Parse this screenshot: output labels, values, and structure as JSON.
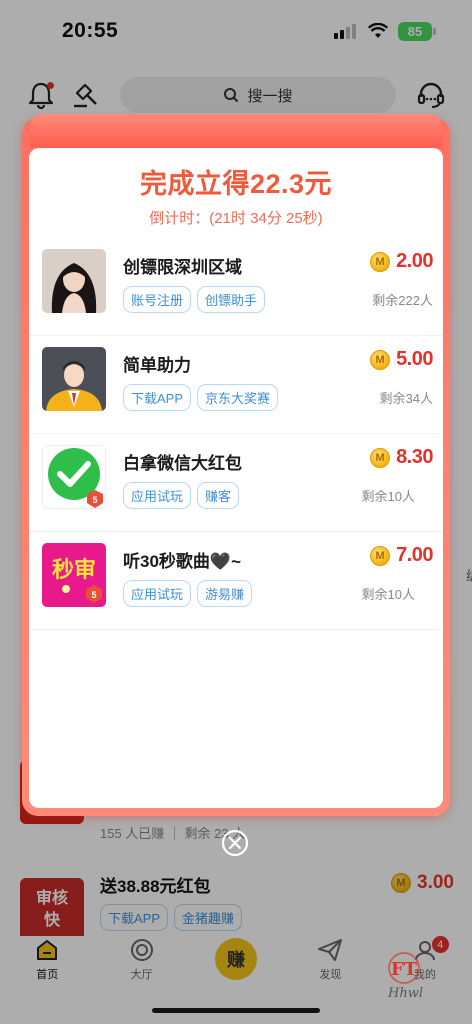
{
  "status_bar": {
    "time": "20:55",
    "battery": "85"
  },
  "header": {
    "search_placeholder": "搜一搜",
    "icons": [
      "bell-icon",
      "gavel-icon",
      "search-icon",
      "headset-icon"
    ]
  },
  "background": {
    "row2_stat": "155 人已赚 ｜ 剩余 23 人",
    "row3": {
      "thumb_text": [
        "审核",
        "快"
      ],
      "title": "送38.88元红包",
      "tags": [
        "下载APP",
        "金猪趣赚"
      ],
      "amount": "3.00"
    },
    "side_char": "编"
  },
  "popup": {
    "title": "完成立得22.3元",
    "countdown": "倒计时：(21时 34分 25秒)",
    "coin_label": "M",
    "tasks": [
      {
        "name": "创镖限深圳区域",
        "amount": "2.00",
        "tags": [
          "账号注册",
          "创镖助手"
        ],
        "remaining": "剩余222人"
      },
      {
        "name": "简单助力",
        "amount": "5.00",
        "tags": [
          "下载APP",
          "京东大奖赛"
        ],
        "remaining": "剩余34人"
      },
      {
        "name": "白拿微信大红包",
        "amount": "8.30",
        "tags": [
          "应用试玩",
          "赚客"
        ],
        "remaining": "剩余10人"
      },
      {
        "name": "听30秒歌曲🖤~",
        "amount": "7.00",
        "tags": [
          "应用试玩",
          "游易赚"
        ],
        "remaining": "剩余10人"
      }
    ],
    "thumb4_text": "秒审",
    "badge_digit": "5"
  },
  "bottom_nav": {
    "items": [
      {
        "label": "首页"
      },
      {
        "label": "大厅"
      },
      {
        "label": "赚"
      },
      {
        "label": "发现"
      },
      {
        "label": "我的"
      }
    ],
    "badge": "4"
  },
  "watermark": {
    "logo": "FT",
    "text": "Hhwl"
  },
  "colors": {
    "accent_red": "#e3322a",
    "title_orange": "#ef5b3a",
    "tag_blue": "#3f8fd8",
    "earn_yellow": "#f2c41b"
  }
}
